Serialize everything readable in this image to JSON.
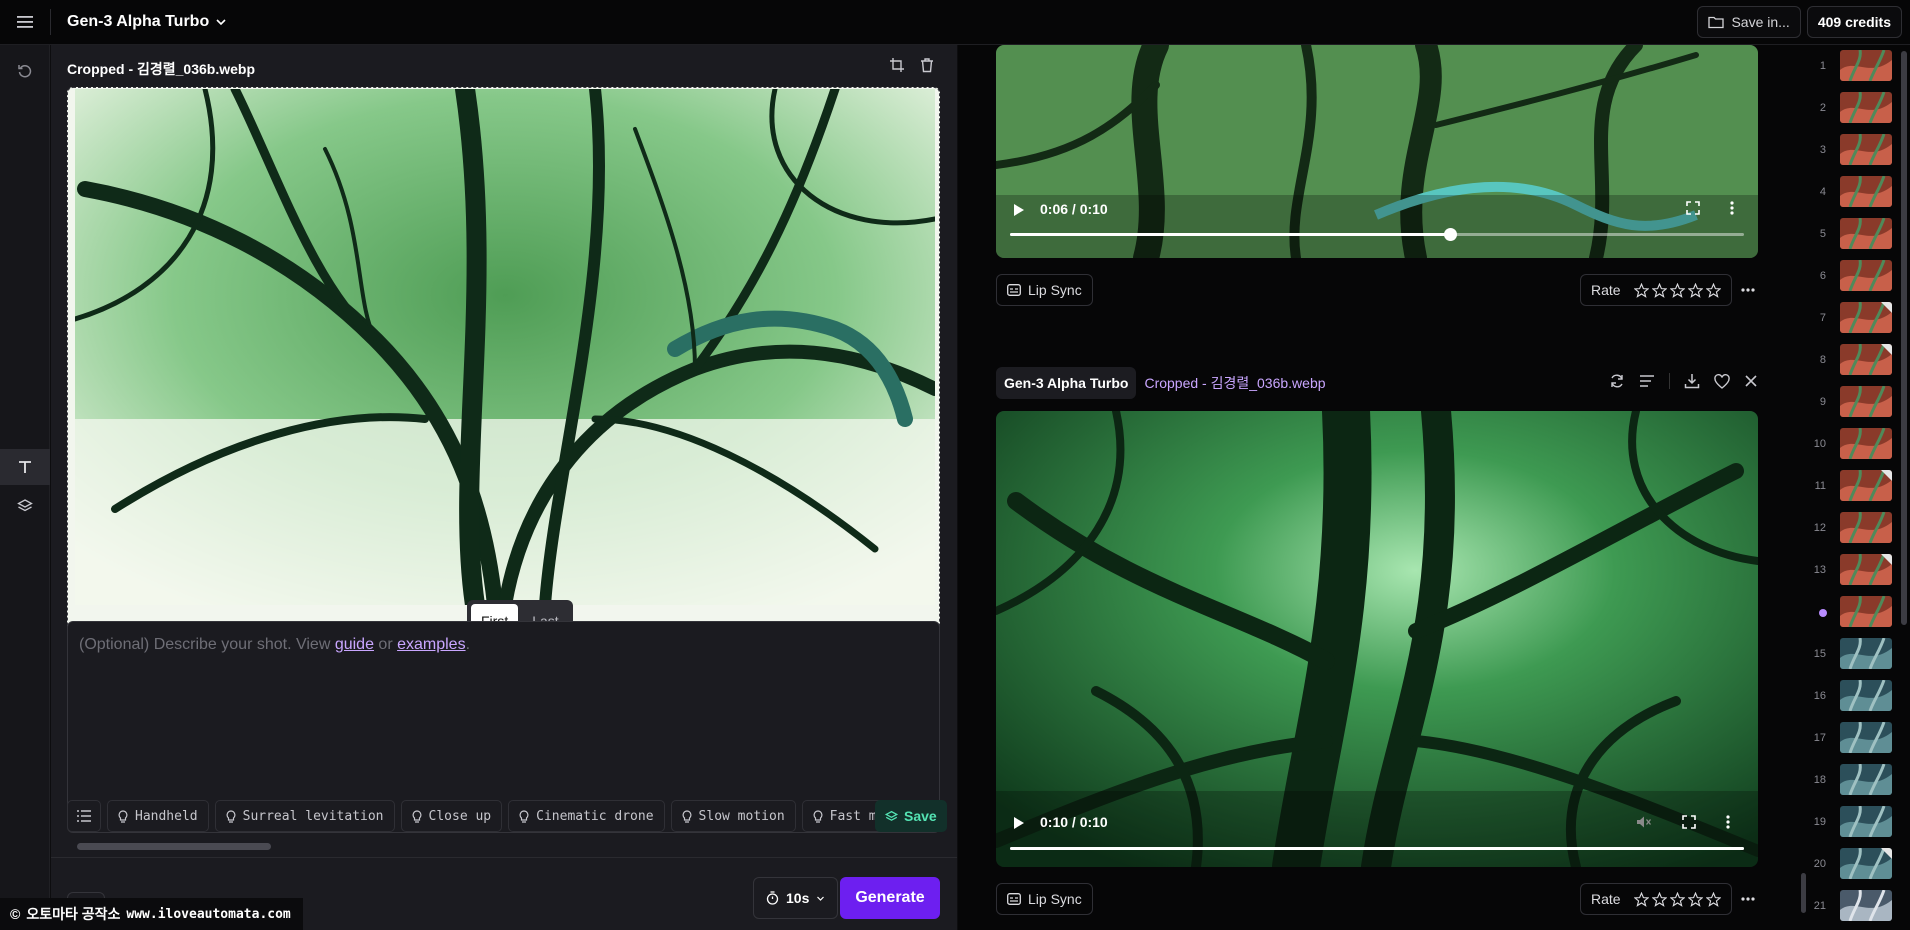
{
  "header": {
    "app_title": "Gen-3 Alpha Turbo",
    "save_label": "Save in...",
    "credits_label": "409 credits"
  },
  "left_panel": {
    "file_title": "Cropped - 김경렬_036b.webp",
    "frame_toggle": {
      "first_label": "First",
      "last_label": "Last",
      "selected": "First"
    },
    "prompt": {
      "placeholder_prefix": "(Optional) Describe your shot. View ",
      "guide_link": "guide",
      "or_text": " or ",
      "examples_link": "examples",
      "suffix": "."
    },
    "chips": [
      "Handheld",
      "Surreal levitation",
      "Close up",
      "Cinematic drone",
      "Slow motion",
      "Fast motion"
    ],
    "save_chip_label": "Save",
    "duration_label": "10s",
    "generate_label": "Generate"
  },
  "feed": {
    "cards": [
      {
        "time_label": "0:06 / 0:10",
        "progress": 0.6,
        "lip_sync_label": "Lip Sync",
        "rate_label": "Rate",
        "rating": 0
      },
      {
        "model_tag": "Gen-3 Alpha Turbo",
        "source_name": "Cropped - 김경렬_036b.webp",
        "time_label": "0:10 / 0:10",
        "progress": 1.0,
        "lip_sync_label": "Lip Sync",
        "rate_label": "Rate",
        "rating": 0
      }
    ]
  },
  "thumbnails": [
    {
      "label": "1",
      "style": "warm"
    },
    {
      "label": "2",
      "style": "warm"
    },
    {
      "label": "3",
      "style": "warm"
    },
    {
      "label": "4",
      "style": "warm"
    },
    {
      "label": "5",
      "style": "warm"
    },
    {
      "label": "6",
      "style": "warm"
    },
    {
      "label": "7",
      "style": "warm",
      "corner": true
    },
    {
      "label": "8",
      "style": "warm",
      "corner": true
    },
    {
      "label": "9",
      "style": "warm"
    },
    {
      "label": "10",
      "style": "warm"
    },
    {
      "label": "11",
      "style": "warm",
      "corner": true
    },
    {
      "label": "12",
      "style": "warm"
    },
    {
      "label": "13",
      "style": "warm",
      "corner": true
    },
    {
      "label": "",
      "style": "warm",
      "current": true
    },
    {
      "label": "15",
      "style": "cool"
    },
    {
      "label": "16",
      "style": "cool"
    },
    {
      "label": "17",
      "style": "cool"
    },
    {
      "label": "18",
      "style": "cool"
    },
    {
      "label": "19",
      "style": "cool"
    },
    {
      "label": "20",
      "style": "cool",
      "corner": true
    },
    {
      "label": "21",
      "style": "sky"
    }
  ],
  "watermark": {
    "symbol": "©",
    "brand": "오토마타 공작소",
    "url": "www.iloveautomata.com"
  },
  "colors": {
    "accent_purple": "#6d1ff0",
    "link_purple": "#c9a6ff",
    "save_green": "#54e3b3"
  }
}
